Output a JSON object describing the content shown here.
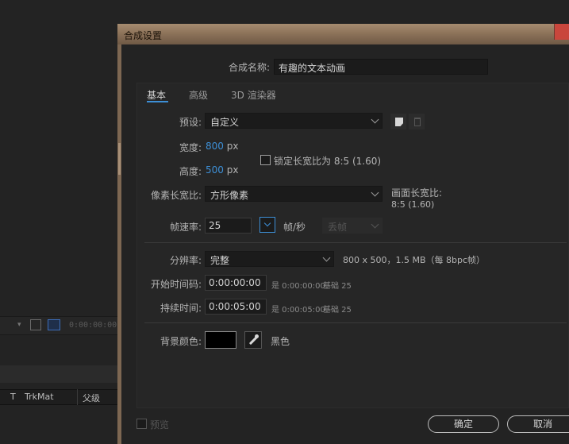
{
  "background": {
    "timecode": "0:00:00:00",
    "columns": {
      "t": "T",
      "trkmat": "TrkMat",
      "parent": "父级"
    }
  },
  "dialog": {
    "title": "合成设置",
    "comp_name_label": "合成名称:",
    "comp_name_value": "有趣的文本动画",
    "tabs": [
      "基本",
      "高级",
      "3D 渲染器"
    ],
    "preset_label": "预设:",
    "preset_value": "自定义",
    "width_label": "宽度:",
    "width_value": "800",
    "height_label": "高度:",
    "height_value": "500",
    "unit_px": "px",
    "lock_aspect_label": "锁定长宽比为 8:5 (1.60)",
    "pixel_aspect_label": "像素长宽比:",
    "pixel_aspect_value": "方形像素",
    "frame_aspect_label": "画面长宽比:",
    "frame_aspect_value": "8:5 (1.60)",
    "frame_rate_label": "帧速率:",
    "frame_rate_value": "25",
    "frame_rate_unit": "帧/秒",
    "drop_frame_value": "丢帧",
    "resolution_label": "分辨率:",
    "resolution_value": "完整",
    "resolution_info": "800 x 500，1.5 MB（每 8bpc帧）",
    "start_tc_label": "开始时间码:",
    "start_tc_value": "0:00:00:00",
    "start_tc_is": "是 0:00:00:00",
    "start_tc_base": "基础 25",
    "duration_label": "持续时间:",
    "duration_value": "0:00:05:00",
    "duration_is": "是 0:00:05:00",
    "duration_base": "基础 25",
    "bg_color_label": "背景颜色:",
    "bg_color_name": "黑色",
    "bg_color_hex": "#000000",
    "preview_label": "预览",
    "ok_label": "确定",
    "cancel_label": "取消"
  }
}
